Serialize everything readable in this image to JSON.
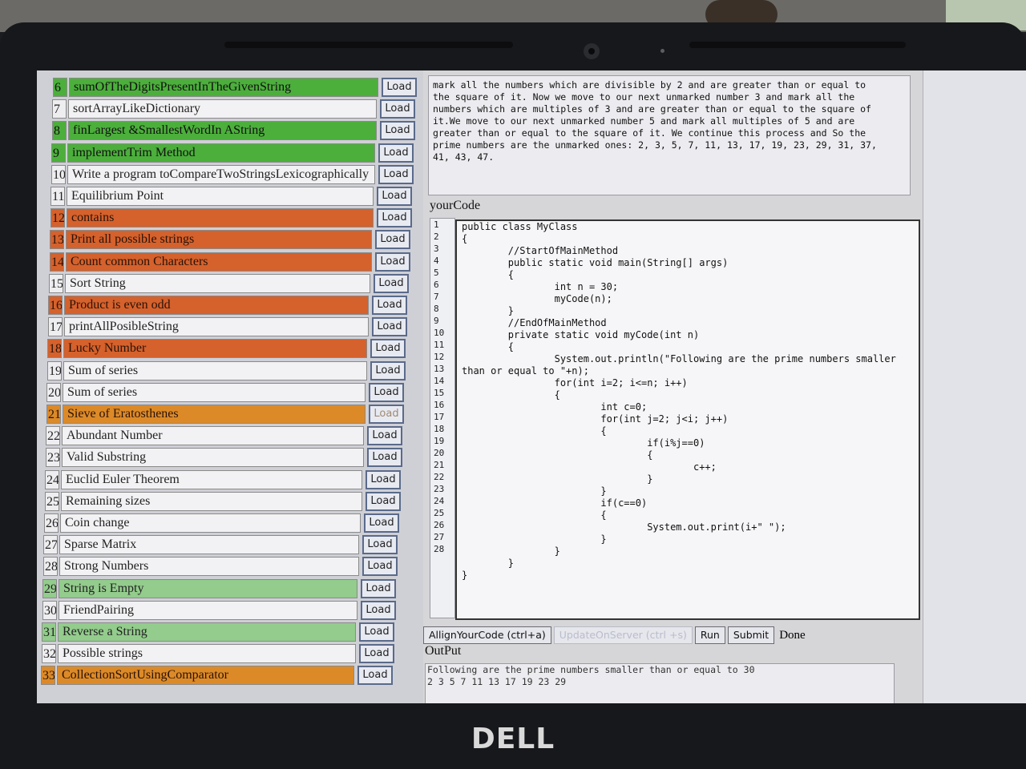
{
  "brand": "DELL",
  "problems": [
    {
      "num": "6",
      "title": "sumOfTheDigitsPresentInTheGivenString",
      "style": "g",
      "load": "Load"
    },
    {
      "num": "7",
      "title": "sortArrayLikeDictionary",
      "style": "",
      "load": "Load"
    },
    {
      "num": "8",
      "title": "finLargest &SmallestWordIn AString",
      "style": "g",
      "load": "Load"
    },
    {
      "num": "9",
      "title": "implementTrim Method",
      "style": "g",
      "load": "Load"
    },
    {
      "num": "10",
      "title": "Write a program toCompareTwoStringsLexicographically",
      "style": "",
      "load": "Load"
    },
    {
      "num": "11",
      "title": "Equilibrium Point",
      "style": "",
      "load": "Load"
    },
    {
      "num": "12",
      "title": "contains",
      "style": "o",
      "load": "Load"
    },
    {
      "num": "13",
      "title": "Print all possible strings",
      "style": "o",
      "load": "Load"
    },
    {
      "num": "14",
      "title": "Count common Characters",
      "style": "o",
      "load": "Load"
    },
    {
      "num": "15",
      "title": "Sort String",
      "style": "",
      "load": "Load"
    },
    {
      "num": "16",
      "title": "Product is even odd",
      "style": "o",
      "load": "Load"
    },
    {
      "num": "17",
      "title": "printAllPosibleString",
      "style": "",
      "load": "Load"
    },
    {
      "num": "18",
      "title": "Lucky Number",
      "style": "o",
      "load": "Load"
    },
    {
      "num": "19",
      "title": "Sum of series",
      "style": "",
      "load": "Load"
    },
    {
      "num": "20",
      "title": "Sum of series",
      "style": "",
      "load": "Load"
    },
    {
      "num": "21",
      "title": "Sieve of Eratosthenes",
      "style": "y",
      "load": "Load"
    },
    {
      "num": "22",
      "title": "Abundant Number",
      "style": "",
      "load": "Load"
    },
    {
      "num": "23",
      "title": "Valid Substring",
      "style": "",
      "load": "Load"
    },
    {
      "num": "24",
      "title": "Euclid Euler Theorem",
      "style": "",
      "load": "Load"
    },
    {
      "num": "25",
      "title": "Remaining sizes",
      "style": "",
      "load": "Load"
    },
    {
      "num": "26",
      "title": "Coin change",
      "style": "",
      "load": "Load"
    },
    {
      "num": "27",
      "title": "Sparse Matrix",
      "style": "",
      "load": "Load"
    },
    {
      "num": "28",
      "title": "Strong Numbers",
      "style": "",
      "load": "Load"
    },
    {
      "num": "29",
      "title": "String is Empty",
      "style": "lg",
      "load": "Load"
    },
    {
      "num": "30",
      "title": "FriendPairing",
      "style": "",
      "load": "Load"
    },
    {
      "num": "31",
      "title": "Reverse a String",
      "style": "lg",
      "load": "Load"
    },
    {
      "num": "32",
      "title": "Possible strings",
      "style": "",
      "load": "Load"
    },
    {
      "num": "33",
      "title": "CollectionSortUsingComparator",
      "style": "y",
      "load": "Load"
    }
  ],
  "description": "mark all the numbers which are divisible by 2 and are greater than or equal to\nthe square of it. Now we move to our next unmarked number 3 and mark all the\nnumbers which are multiples of 3 and are greater than or equal to the square of\nit.We move to our next unmarked number 5 and mark all multiples of 5 and are\ngreater than or equal to the square of it. We continue this process and So the\nprime numbers are the unmarked ones: 2, 3, 5, 7, 11, 13, 17, 19, 23, 29, 31, 37,\n41, 43, 47.",
  "your_code_label": "yourCode",
  "line_numbers": [
    "1",
    "2",
    "3",
    "4",
    "5",
    "6",
    "7",
    "8",
    "9",
    "10",
    "11",
    "12",
    "13",
    "14",
    "15",
    "16",
    "17",
    "18",
    "19",
    "20",
    "21",
    "22",
    "23",
    "24",
    "25",
    "26",
    "27",
    "28"
  ],
  "code": "public class MyClass\n{\n        //StartOfMainMethod\n        public static void main(String[] args)\n        {\n                int n = 30;\n                myCode(n);\n        }\n        //EndOfMainMethod\n        private static void myCode(int n)\n        {\n                System.out.println(\"Following are the prime numbers smaller\nthan or equal to \"+n);\n                for(int i=2; i<=n; i++)\n                {\n                        int c=0;\n                        for(int j=2; j<i; j++)\n                        {\n                                if(i%j==0)\n                                {\n                                        c++;\n                                }\n                        }\n                        if(c==0)\n                        {\n                                System.out.print(i+\" \");\n                        }\n                }\n        }\n}",
  "buttons": {
    "align": "AllignYourCode (ctrl+a)",
    "update": "UpdateOnServer (ctrl +s)",
    "run": "Run",
    "submit": "Submit",
    "status": "Done"
  },
  "output_label": "OutPut",
  "output": "Following are the prime numbers smaller than or equal to 30\n2 3 5 7 11 13 17 19 23 29"
}
